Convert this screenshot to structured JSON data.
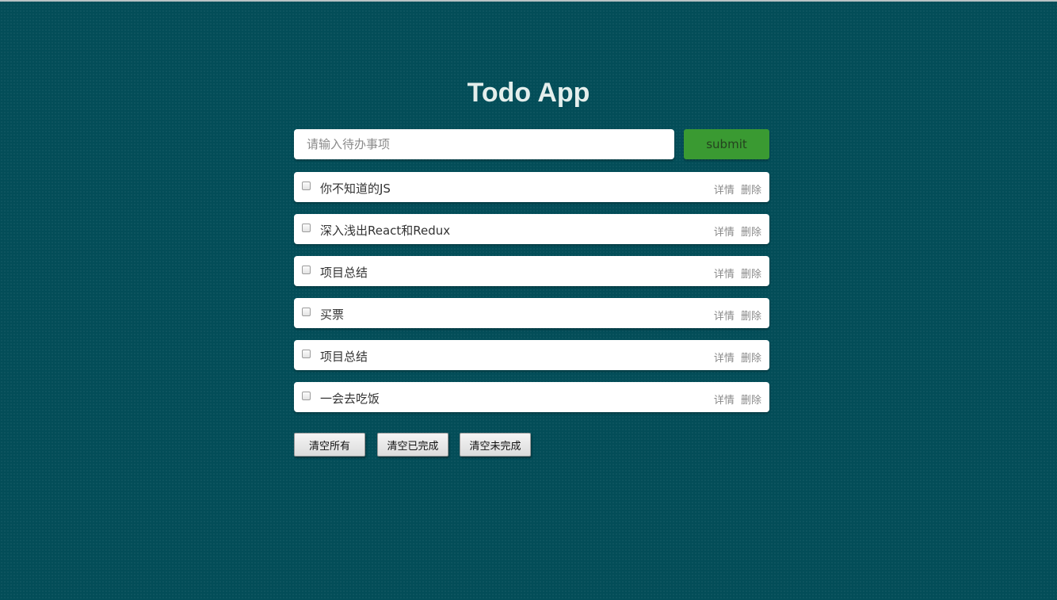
{
  "app": {
    "title": "Todo App"
  },
  "form": {
    "input_value": "",
    "input_placeholder": "请输入待办事项",
    "submit_label": "submit"
  },
  "todos": [
    {
      "text": "你不知道的JS",
      "completed": false,
      "detail_label": "详情",
      "delete_label": "删除"
    },
    {
      "text": "深入浅出React和Redux",
      "completed": false,
      "detail_label": "详情",
      "delete_label": "删除"
    },
    {
      "text": "项目总结",
      "completed": false,
      "detail_label": "详情",
      "delete_label": "删除"
    },
    {
      "text": "买票",
      "completed": false,
      "detail_label": "详情",
      "delete_label": "删除"
    },
    {
      "text": "项目总结",
      "completed": false,
      "detail_label": "详情",
      "delete_label": "删除"
    },
    {
      "text": "一会去吃饭",
      "completed": false,
      "detail_label": "详情",
      "delete_label": "删除"
    }
  ],
  "footer": {
    "clear_all_label": "清空所有",
    "clear_completed_label": "清空已完成",
    "clear_uncompleted_label": "清空未完成"
  },
  "colors": {
    "background": "#034d58",
    "submit_button": "#3a9a32",
    "title": "#e4eeec"
  }
}
